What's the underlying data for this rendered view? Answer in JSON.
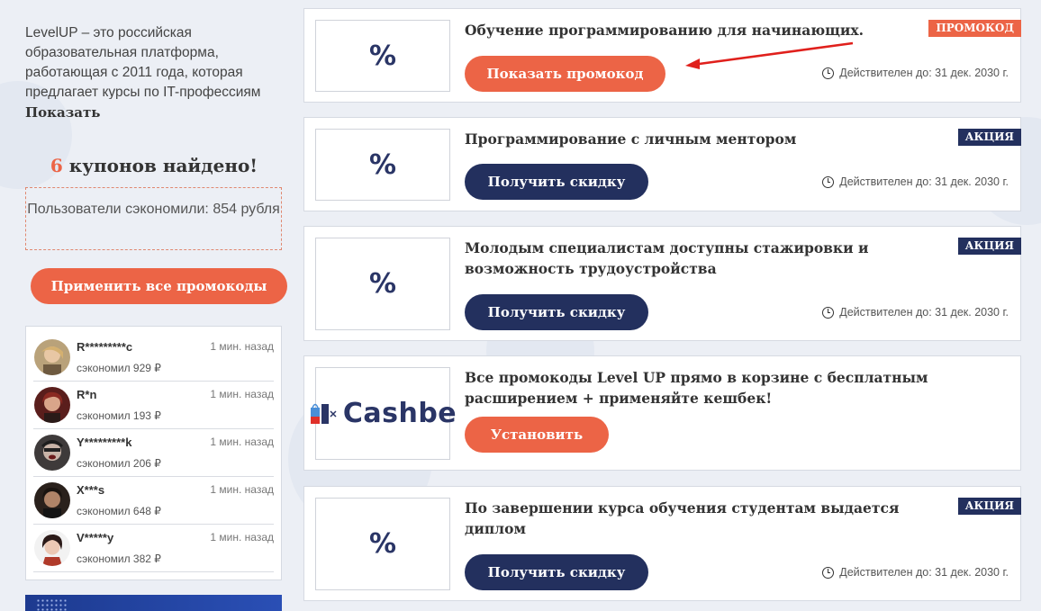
{
  "sidebar": {
    "description": "LevelUP – это российская образовательная платформа, работающая с 2011 года, которая предлагает курсы по IT-профессиям",
    "show_more": "Показать",
    "found_count": "6",
    "found_text": " купонов найдено!",
    "saved_text": "Пользователи сэкономили: 854 рубля",
    "apply_all": "Применить все промокоды",
    "users": [
      {
        "name": "R*********c",
        "time": "1 мин. назад",
        "saved": "сэкономил 929 ₽",
        "avatar_color": "#c8a070"
      },
      {
        "name": "R*n",
        "time": "1 мин. назад",
        "saved": "сэкономил 193 ₽",
        "avatar_color": "#7a2e2a"
      },
      {
        "name": "Y*********k",
        "time": "1 мин. назад",
        "saved": "сэкономил 206 ₽",
        "avatar_color": "#5a4a45"
      },
      {
        "name": "X***s",
        "time": "1 мин. назад",
        "saved": "сэкономил 648 ₽",
        "avatar_color": "#3a2c25"
      },
      {
        "name": "V*****y",
        "time": "1 мин. назад",
        "saved": "сэкономил 382 ₽",
        "avatar_color": "#9a4030"
      }
    ]
  },
  "coupons": [
    {
      "logo": "%",
      "title": "Обучение программированию для начинающих.",
      "tag": "ПРОМОКОД",
      "button": "Показать промокод",
      "valid": "Действителен до: 31 дек. 2030 г."
    },
    {
      "logo": "%",
      "title": "Программирование с личным ментором",
      "tag": "АКЦИЯ",
      "button": "Получить скидку",
      "valid": "Действителен до: 31 дек. 2030 г."
    },
    {
      "logo": "%",
      "title": "Молодым специалистам доступны стажировки и возможность трудоустройства",
      "tag": "АКЦИЯ",
      "button": "Получить скидку",
      "valid": "Действителен до: 31 дек. 2030 г."
    },
    {
      "logo": "Cashbe",
      "title": "Все промокоды Level UP прямо в корзине с бесплатным расширением + применяйте кешбек!",
      "button": "Установить"
    },
    {
      "logo": "%",
      "title": "По завершении курса обучения студентам выдается диплом",
      "tag": "АКЦИЯ",
      "button": "Получить скидку",
      "valid": "Действителен до: 31 дек. 2030 г."
    }
  ],
  "colors": {
    "accent": "#ec6446",
    "navy": "#23305e",
    "background": "#eceff5",
    "arrow": "#e0201c"
  }
}
